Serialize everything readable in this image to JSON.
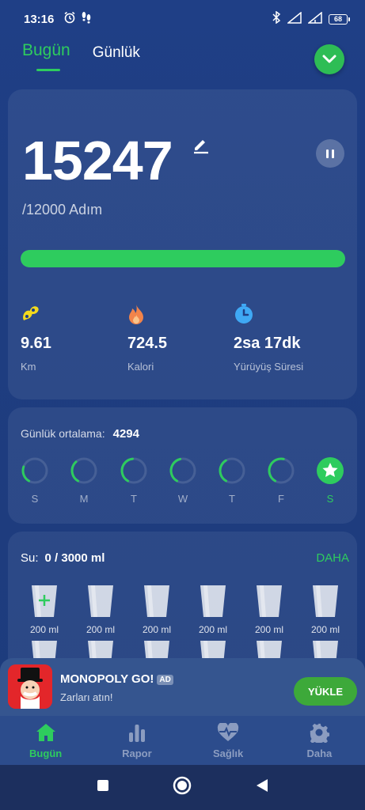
{
  "status_bar": {
    "time": "13:16",
    "battery": "68",
    "icons": [
      "alarm-icon",
      "footsteps-icon",
      "bluetooth-icon",
      "signal-icon",
      "wifi-icon",
      "battery-icon"
    ]
  },
  "tabs": [
    {
      "label": "Bugün",
      "active": true
    },
    {
      "label": "Günlük",
      "active": false
    }
  ],
  "steps": {
    "value": "15247",
    "goal_text": "/12000 Adım",
    "progress": 1.0,
    "stats": [
      {
        "icon": "footprint-icon",
        "value": "9.61",
        "label": "Km",
        "color": "#f3d91d"
      },
      {
        "icon": "flame-icon",
        "value": "724.5",
        "label": "Kalori",
        "color": "#f2844a"
      },
      {
        "icon": "stopwatch-icon",
        "value": "2sa 17dk",
        "label": "Yürüyüş Süresi",
        "color": "#3fa9f5"
      }
    ]
  },
  "weekly": {
    "label": "Günlük ortalama:",
    "value": "4294",
    "days": [
      {
        "label": "S",
        "progress": 0.22
      },
      {
        "label": "M",
        "progress": 0.3
      },
      {
        "label": "T",
        "progress": 0.4
      },
      {
        "label": "W",
        "progress": 0.38
      },
      {
        "label": "T",
        "progress": 0.33
      },
      {
        "label": "F",
        "progress": 0.45
      },
      {
        "label": "S",
        "progress": 1.0,
        "today": true
      }
    ]
  },
  "water": {
    "label": "Su:",
    "value": "0 / 3000 ml",
    "more": "DAHA",
    "glasses": [
      "200 ml",
      "200 ml",
      "200 ml",
      "200 ml",
      "200 ml",
      "200 ml"
    ]
  },
  "ad": {
    "title": "MONOPOLY GO!",
    "badge": "AD",
    "subtitle": "Zarları atın!",
    "button": "YÜKLE"
  },
  "bottom_nav": [
    {
      "label": "Bugün",
      "icon": "home-icon",
      "active": true
    },
    {
      "label": "Rapor",
      "icon": "bar-chart-icon",
      "active": false
    },
    {
      "label": "Sağlık",
      "icon": "heart-pulse-icon",
      "active": false
    },
    {
      "label": "Daha",
      "icon": "gear-icon",
      "active": false
    }
  ],
  "colors": {
    "accent": "#2ecc5e",
    "background": "#1f3f86"
  }
}
